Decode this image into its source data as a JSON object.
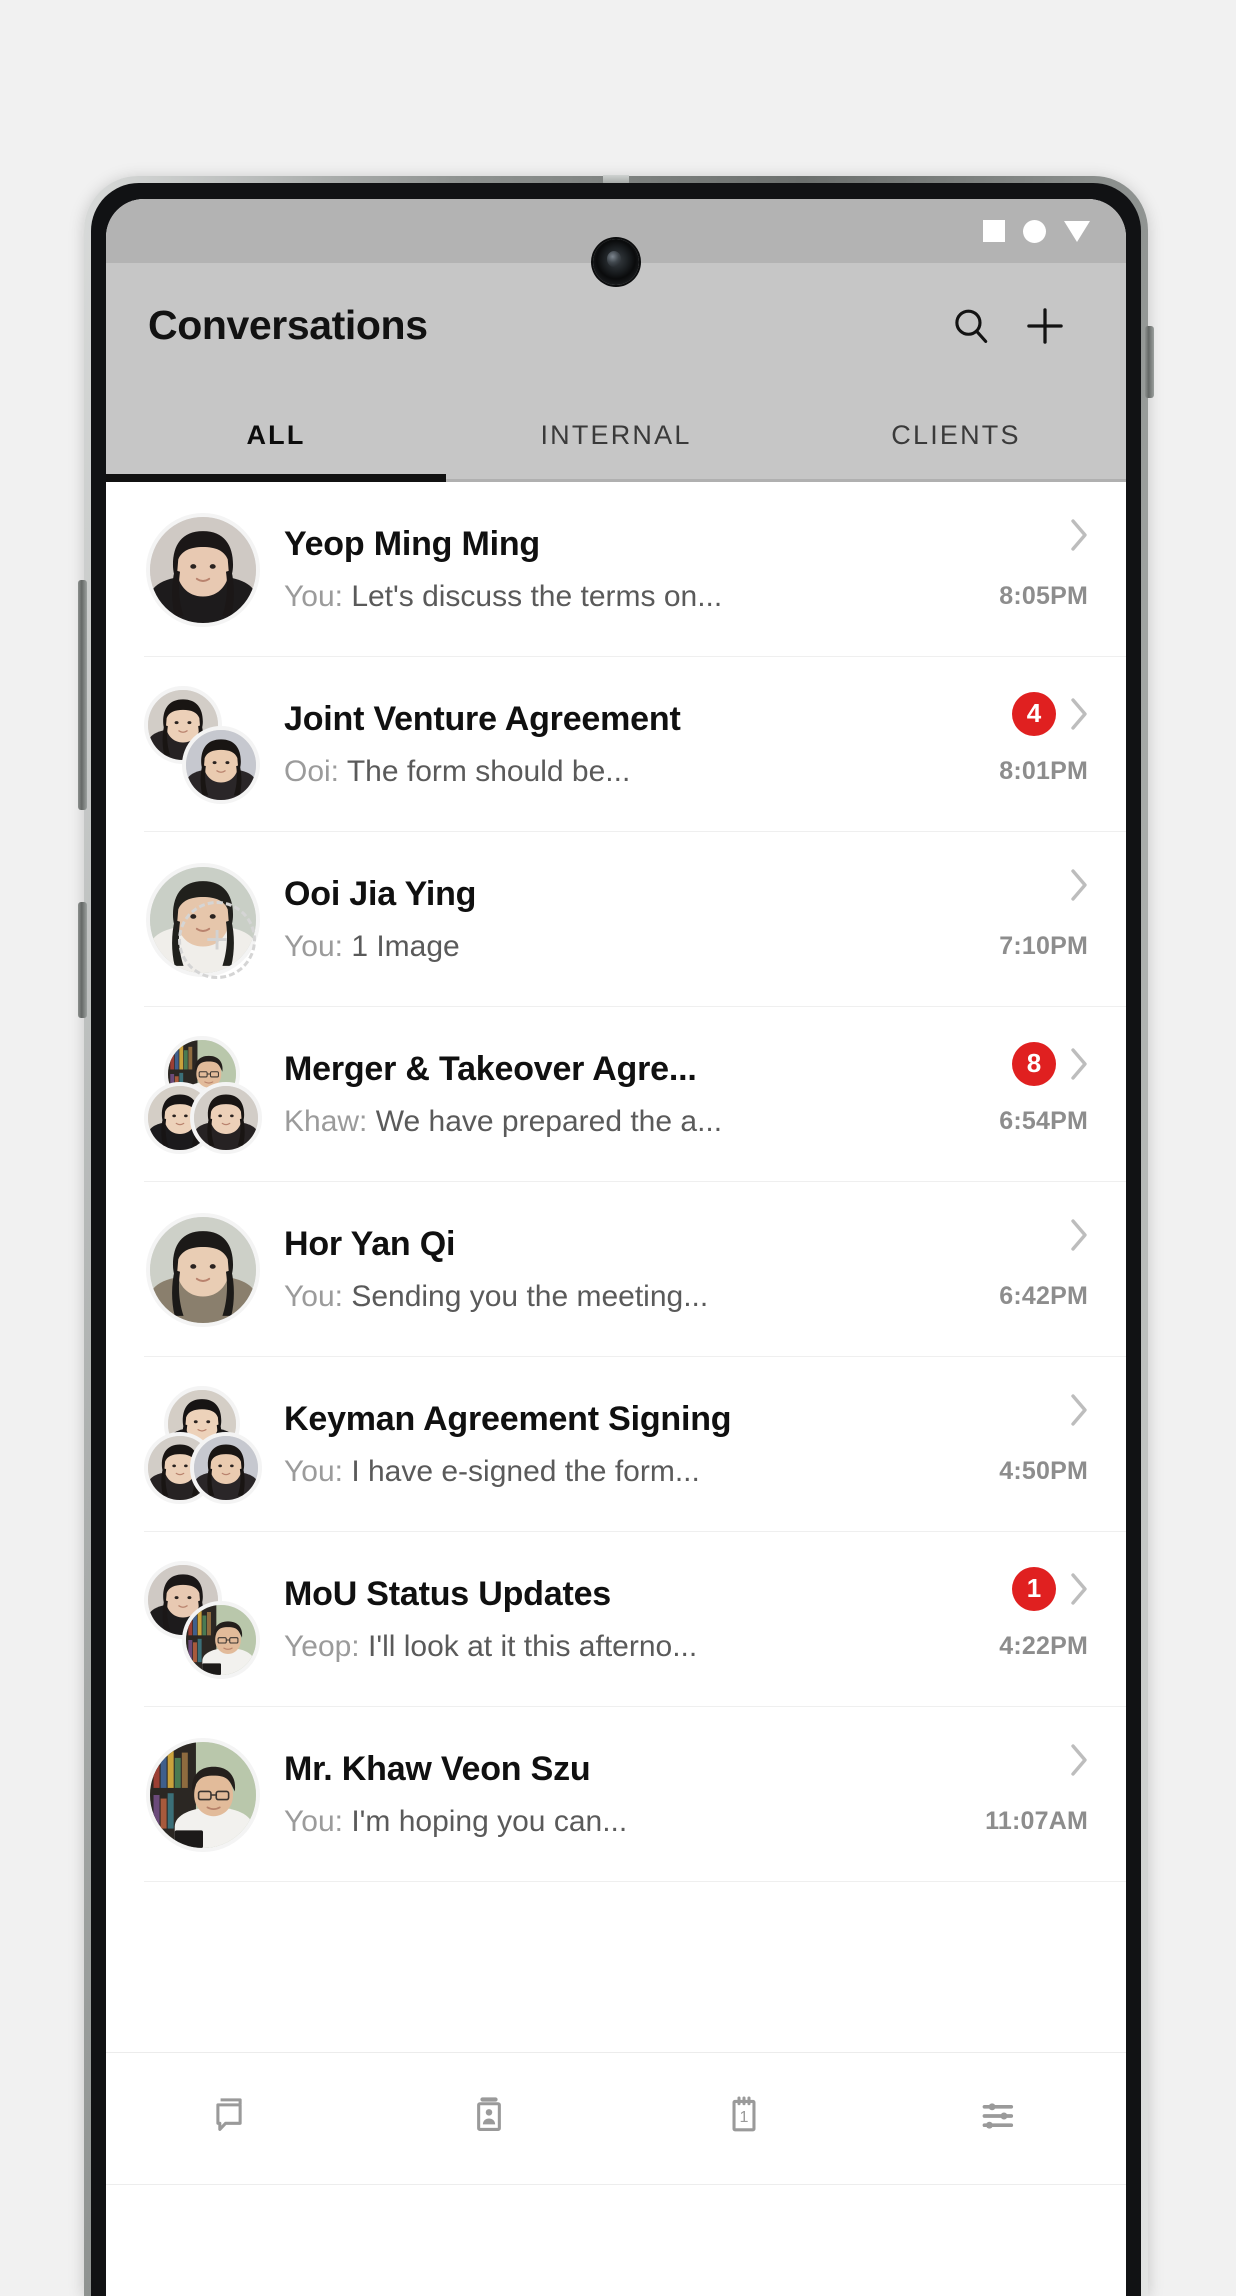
{
  "status_bar": {
    "icons": [
      "stop-square-icon",
      "record-circle-icon",
      "dropdown-triangle-icon"
    ]
  },
  "header": {
    "title": "Conversations",
    "actions": [
      {
        "name": "search-icon",
        "label": "Search"
      },
      {
        "name": "plus-icon",
        "label": "New conversation"
      }
    ]
  },
  "tabs": {
    "active_index": 0,
    "items": [
      {
        "label": "ALL"
      },
      {
        "label": "INTERNAL"
      },
      {
        "label": "CLIENTS"
      }
    ]
  },
  "conversations": [
    {
      "title": "Yeop Ming Ming",
      "sender": "You:",
      "preview": "Let's discuss the terms on...",
      "time": "8:05PM",
      "badge": "",
      "avatar_type": "single"
    },
    {
      "title": "Joint Venture Agreement",
      "sender": "Ooi:",
      "preview": "The form should be...",
      "time": "8:01PM",
      "badge": "4",
      "avatar_type": "pair"
    },
    {
      "title": "Ooi Jia Ying",
      "sender": "You:",
      "preview": "1 Image",
      "time": "7:10PM",
      "badge": "",
      "avatar_type": "single-placeholder"
    },
    {
      "title": "Merger & Takeover Agre...",
      "sender": "Khaw:",
      "preview": "We have prepared the a...",
      "time": "6:54PM",
      "badge": "8",
      "avatar_type": "trio"
    },
    {
      "title": "Hor Yan Qi",
      "sender": "You:",
      "preview": "Sending you the meeting...",
      "time": "6:42PM",
      "badge": "",
      "avatar_type": "single"
    },
    {
      "title": "Keyman Agreement Signing",
      "sender": "You:",
      "preview": "I have e-signed the form...",
      "time": "4:50PM",
      "badge": "",
      "avatar_type": "trio"
    },
    {
      "title": "MoU Status Updates",
      "sender": "Yeop:",
      "preview": "I'll look at it this afterno...",
      "time": "4:22PM",
      "badge": "1",
      "avatar_type": "pair"
    },
    {
      "title": "Mr. Khaw Veon Szu",
      "sender": "You:",
      "preview": "I'm hoping you can...",
      "time": "11:07AM",
      "badge": "",
      "avatar_type": "single"
    }
  ],
  "bottom_nav": {
    "items": [
      {
        "name": "chat-bubbles-icon",
        "label": "Conversations"
      },
      {
        "name": "contact-card-icon",
        "label": "Contacts"
      },
      {
        "name": "calendar-icon",
        "label": "Calendar",
        "day": "1"
      },
      {
        "name": "sliders-settings-icon",
        "label": "Settings"
      }
    ]
  },
  "colors": {
    "badge_red": "#e02020",
    "header_gray": "#c6c6c6",
    "status_gray": "#b3b3b3",
    "accent_underline": "#111111"
  }
}
